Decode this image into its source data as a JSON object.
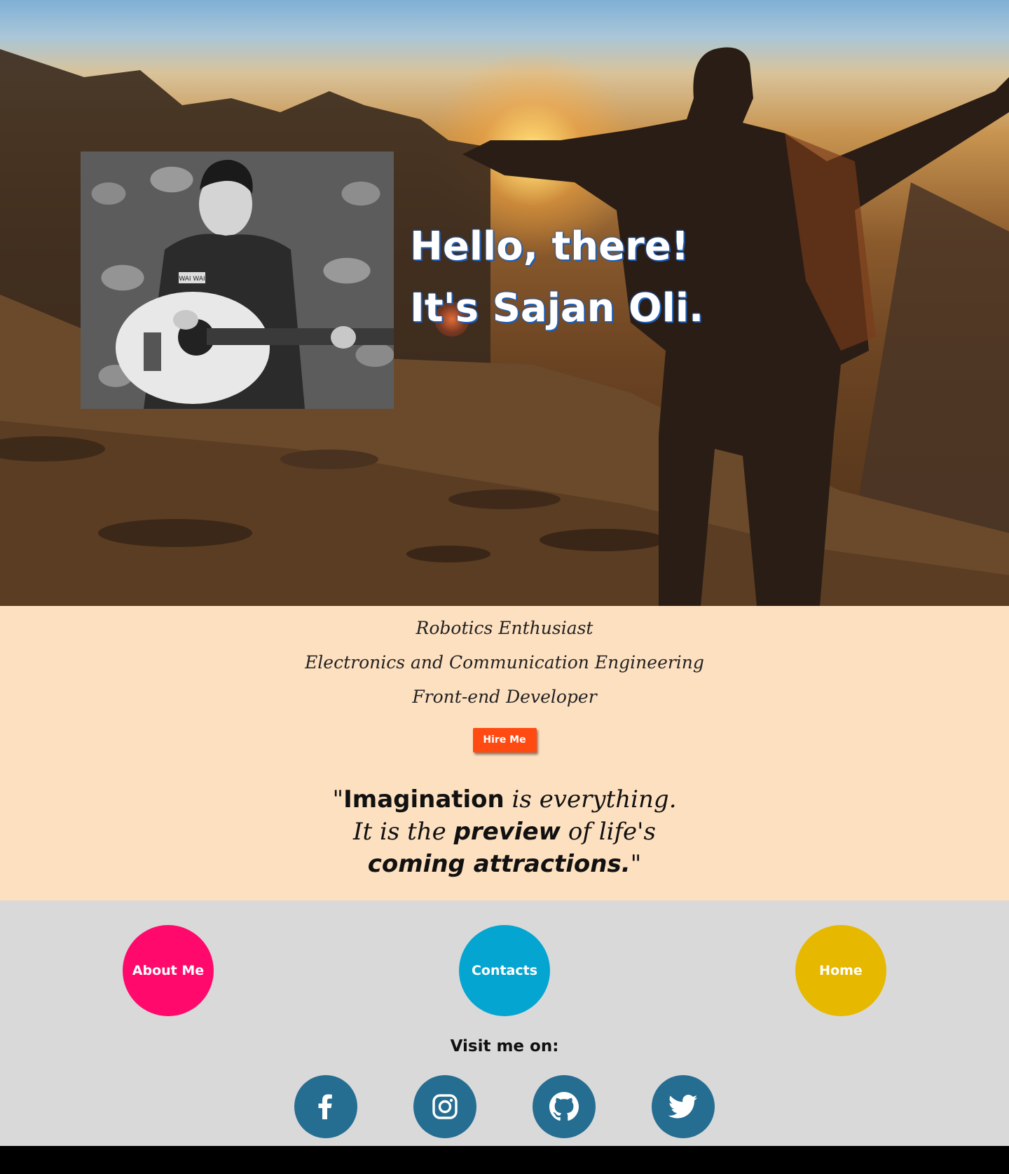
{
  "hero": {
    "greeting_line1": "Hello, there!",
    "greeting_line2": "It's Sajan Oli.",
    "portrait_shirt_label": "WAI WAI"
  },
  "info": {
    "roles": [
      "Robotics Enthusiast",
      "Electronics and Communication Engineering",
      "Front-end Developer"
    ],
    "hire_label": "Hire Me",
    "quote": {
      "open": "\"",
      "w1": "Imagination",
      "t1": " is everything.",
      "t2": "It is the ",
      "w2": "preview",
      "t3": " of life's",
      "w3": "coming attractions.",
      "close": "\""
    }
  },
  "nav": {
    "about_label": "About Me",
    "contacts_label": "Contacts",
    "home_label": "Home",
    "visit_label": "Visit me on:"
  },
  "social": [
    {
      "icon": "facebook-icon"
    },
    {
      "icon": "instagram-icon"
    },
    {
      "icon": "github-icon"
    },
    {
      "icon": "twitter-icon"
    }
  ],
  "colors": {
    "info_bg": "#fde0c0",
    "hire": "#ff4a12",
    "about": "#ff0a6c",
    "contacts": "#05a5d1",
    "home": "#e7b800",
    "social": "#256e92",
    "nav_bg": "#d9d9d9"
  }
}
